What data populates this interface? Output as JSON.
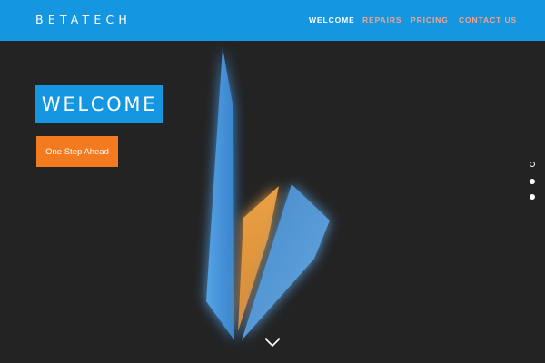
{
  "header": {
    "brand": "BETATECH",
    "nav": [
      {
        "label": "WELCOME",
        "color": "#ffffff"
      },
      {
        "label": "REPAIRS",
        "color": "#f4a38a"
      },
      {
        "label": "PRICING",
        "color": "#f4a38a"
      },
      {
        "label": "CONTACT US",
        "color": "#f4a38a"
      }
    ],
    "background": "#1596e0"
  },
  "hero": {
    "title": "WELCOME",
    "title_background": "#1596e0",
    "cta_label": "One Step Ahead",
    "cta_background": "#f47a20",
    "cta_text_color": "#ffffff",
    "scroll_icon": "chevron-down-icon",
    "slide_indicators": [
      {
        "active": true
      },
      {
        "active": false
      },
      {
        "active": false
      }
    ]
  },
  "colors": {
    "page_background": "#232323",
    "accent_blue": "#4aa0e8",
    "accent_orange": "#f2a040"
  }
}
